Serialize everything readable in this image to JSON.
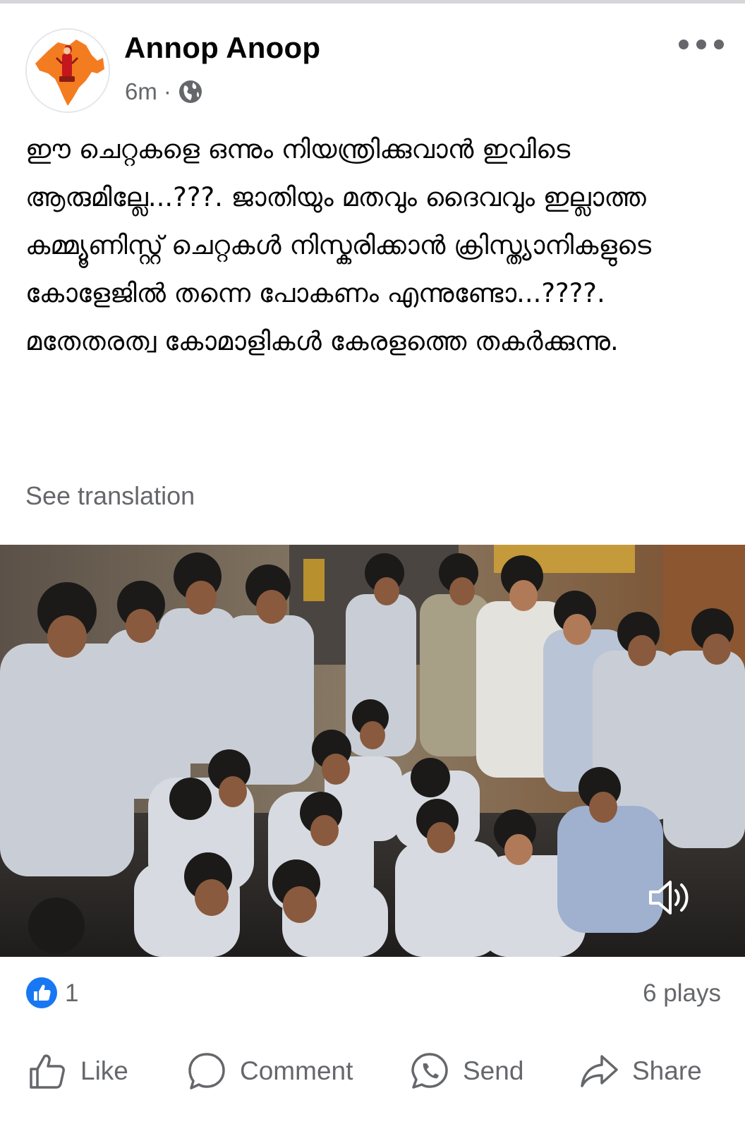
{
  "post": {
    "author": "Annop Anoop",
    "time": "6m",
    "separator": "·",
    "privacy_icon": "globe-icon",
    "more_icon": "more-options-icon",
    "text": "ഈ ചെറ്റകളെ ഒന്നും നിയന്ത്രിക്കുവാൻ ഇവിടെ ആരുമില്ലേ...???. ജാതിയും മതവും ദൈവവും ഇല്ലാത്ത കമ്മ്യൂണിസ്റ്റ് ചെറ്റകൾ നിസ്കരിക്കാൻ ക്രിസ്ത്യാനികളുടെ കോളേജിൽ തന്നെ പോകണം എന്നുണ്ടോ...????. മതേതരത്വ കോമാളികൾ കേരളത്തെ തകർക്കുന്നു.",
    "see_translation": "See translation"
  },
  "video": {
    "sound_icon": "speaker-icon"
  },
  "stats": {
    "reaction_icon": "like-reaction-icon",
    "reaction_count": "1",
    "plays": "6 plays"
  },
  "actions": [
    {
      "label": "Like",
      "icon": "thumbs-up-icon"
    },
    {
      "label": "Comment",
      "icon": "comment-icon"
    },
    {
      "label": "Send",
      "icon": "whatsapp-icon"
    },
    {
      "label": "Share",
      "icon": "share-icon"
    }
  ],
  "colors": {
    "text_primary": "#050505",
    "text_secondary": "#65676b",
    "like_blue": "#1877f2",
    "avatar_orange": "#f47c20"
  }
}
